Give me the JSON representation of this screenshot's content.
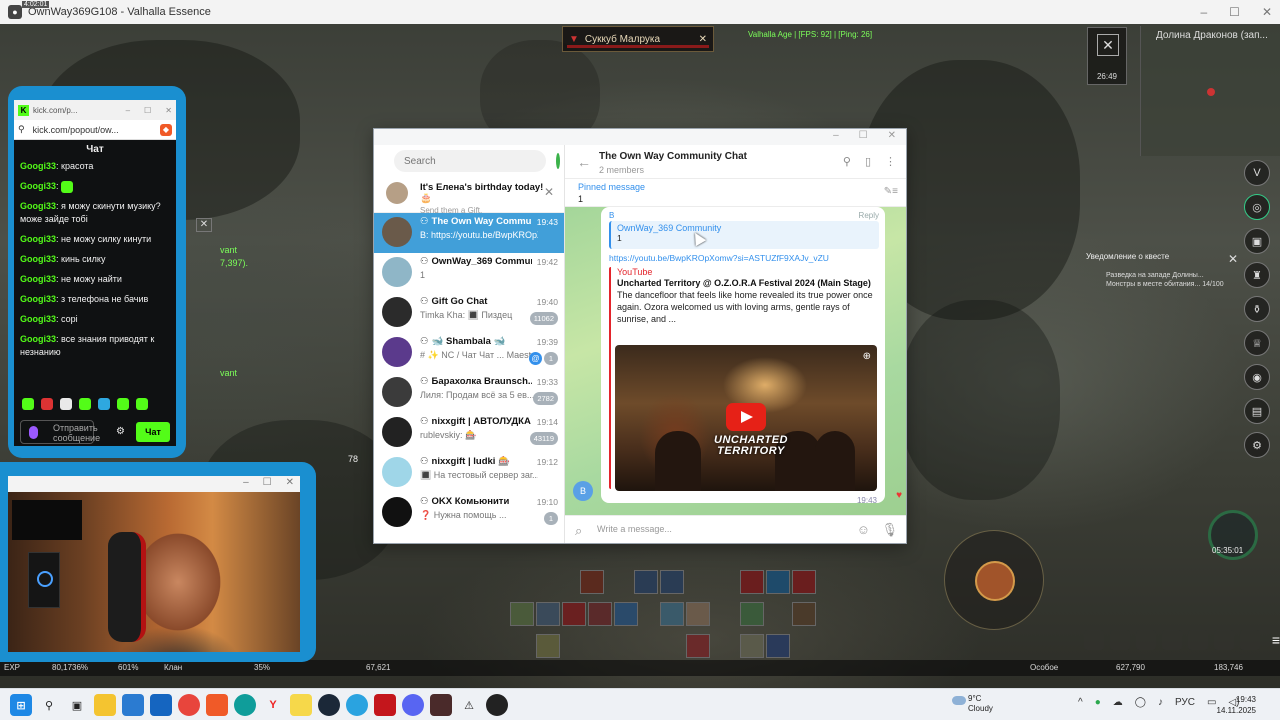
{
  "window": {
    "title": "OwnWay369G108 - Valhalla Essence",
    "rec_indicator": "4:02:01"
  },
  "game": {
    "target_name": "Суккуб Малрука",
    "fps_readout": "Valhalla Age | [FPS: 92] | [Ping: 26]",
    "zone_name": "Долина Драконов (зап...",
    "map_clock": "26:49",
    "quest_notice_title": "Уведомление о квесте",
    "quest_line1": "Разведка на западе Долины...",
    "quest_line2": "Монстры в месте обитания... 14/100",
    "timer": "05:35:01",
    "side_fragment_1": "vant",
    "side_fragment_2": "7,397).",
    "side_fragment_3": "vant",
    "level_label": "78",
    "status": {
      "exp_label": "EXP",
      "exp_value": "80,1736%",
      "val2": "601%",
      "clan": "Клан",
      "val3": "35%",
      "val4": "67,621",
      "special": "Особое",
      "gold": "627,790",
      "money": "183,746"
    }
  },
  "kick": {
    "tab_url": "kick.com/p...",
    "address": "kick.com/popout/ow...",
    "header": "Чат",
    "messages": [
      {
        "user": "Googi33",
        "text": "красота"
      },
      {
        "user": "Googi33",
        "text": ""
      },
      {
        "user": "Googi33",
        "text": "я можу скинути музику? може зайде тобі"
      },
      {
        "user": "Googi33",
        "text": "не можу силку кинути"
      },
      {
        "user": "Googi33",
        "text": "кинь силку"
      },
      {
        "user": "Googi33",
        "text": "не можу найти"
      },
      {
        "user": "Googi33",
        "text": "з телефона не бачив"
      },
      {
        "user": "Googi33",
        "text": "сорі"
      },
      {
        "user": "Googi33",
        "text": "все знания приводят к незнанию"
      }
    ],
    "input_placeholder": "Отправить сообщение",
    "send_label": "Чат"
  },
  "telegram": {
    "search_placeholder": "Search",
    "birthday": {
      "title": "It's Елена's birthday today! 🎂",
      "sub": "Send them a Gift."
    },
    "chats": [
      {
        "name": "The Own Way Commu...",
        "preview": "B: https://youtu.be/BwpKROpXo...",
        "time": "19:43",
        "active": true,
        "group": true,
        "badge": "",
        "mention": false,
        "color": "#6a5a4a"
      },
      {
        "name": "OwnWay_369 Commun...",
        "preview": "1",
        "time": "19:42",
        "active": false,
        "group": true,
        "badge": "",
        "mention": false,
        "color": "#8fb6c7"
      },
      {
        "name": "Gift Go Chat",
        "preview": "Timka Kha: 🔳 Пиздец",
        "time": "19:40",
        "active": false,
        "group": true,
        "badge": "11062",
        "mention": false,
        "color": "#2b2b2b"
      },
      {
        "name": "🐋 Shambala 🐋",
        "preview": "# ✨ NC / Чат Чат ...  Maestro: Ну все равно ...",
        "time": "19:39",
        "active": false,
        "group": true,
        "badge": "1",
        "mention": true,
        "color": "#5b3a8c"
      },
      {
        "name": "Барахолка Braunsch...",
        "preview": "Лиля: Продам всё за 5 ев...",
        "time": "19:33",
        "active": false,
        "group": true,
        "badge": "2782",
        "mention": false,
        "color": "#3b3b3b"
      },
      {
        "name": "nixxgift | АВТОЛУДКА",
        "preview": "rublevskiy: 🎰",
        "time": "19:14",
        "active": false,
        "group": true,
        "badge": "43119",
        "mention": false,
        "color": "#222"
      },
      {
        "name": "nixxgift | ludki 🎰",
        "preview": "🔳 На тестовый сервер заг...",
        "time": "19:12",
        "active": false,
        "group": true,
        "badge": "",
        "mention": false,
        "color": "#9fd6e8"
      },
      {
        "name": "OKX Комьюнити",
        "preview": "❓ Нужна помощь ...",
        "time": "19:10",
        "active": false,
        "group": true,
        "badge": "1",
        "mention": false,
        "color": "#111"
      }
    ],
    "chat_title": "The Own Way Community Chat",
    "chat_subtitle": "2 members",
    "pinned_label": "Pinned message",
    "pinned_value": "1",
    "message": {
      "sender": "B",
      "reply_label": "Reply",
      "quote_name": "OwnWay_369 Community",
      "quote_text": "1",
      "link": "https://youtu.be/BwpKROpXomw?si=ASTUZfF9XAJv_vZU",
      "site": "YouTube",
      "title": "Uncharted Territory @ O.Z.O.R.A Festival 2024 (Main Stage)",
      "desc": "The dancefloor that feels like home revealed its true power once again. Ozora welcomed us with loving arms, gentle rays of sunrise, and ...",
      "video_text": "UNCHARTED TERRITORY",
      "time": "19:43",
      "avatar_letter": "B"
    },
    "input_placeholder": "Write a message..."
  },
  "taskbar": {
    "weather_temp": "9°C",
    "weather_desc": "Cloudy",
    "lang": "РУС",
    "time": "19:43",
    "date": "14.11.2025"
  }
}
